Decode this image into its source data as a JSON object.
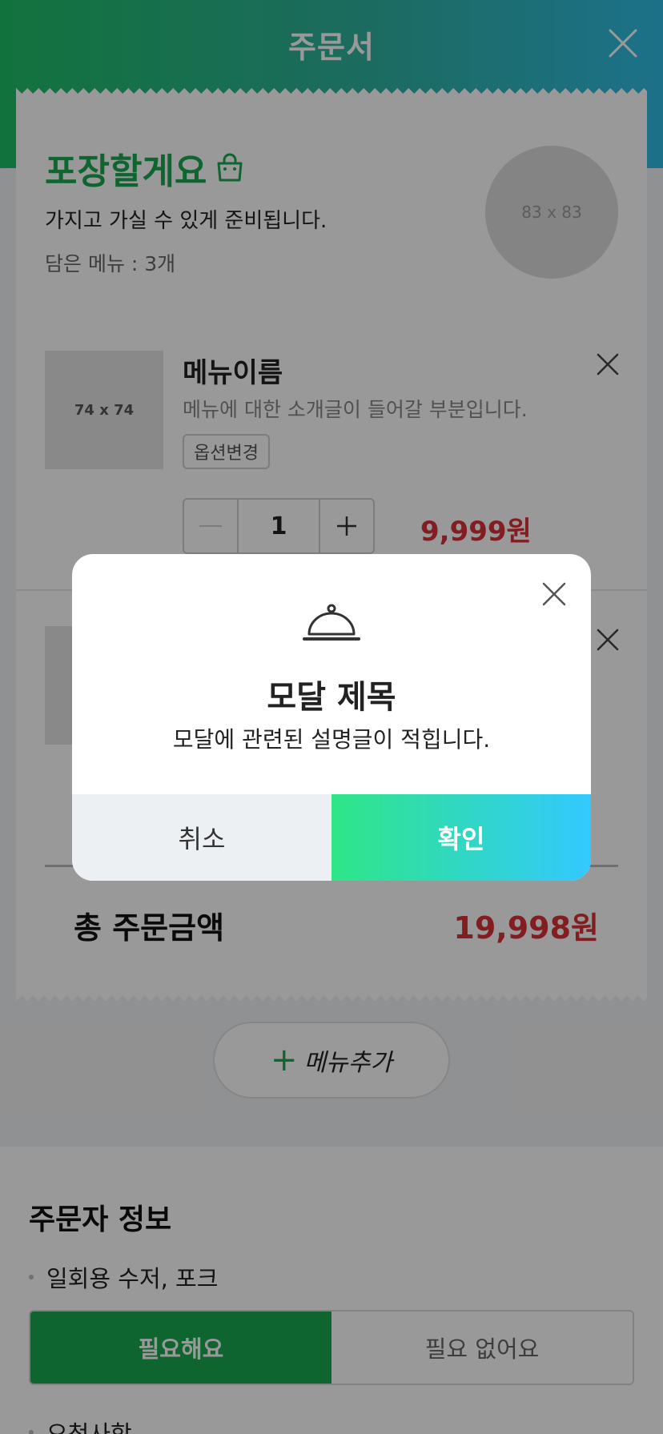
{
  "header": {
    "title": "주문서"
  },
  "order": {
    "mode_title": "포장할게요",
    "mode_desc": "가지고 가실 수 있게 준비됩니다.",
    "menu_count": "담은 메뉴 : 3개",
    "image_placeholder": "83 x 83"
  },
  "items": [
    {
      "thumb": "74 x 74",
      "name": "메뉴이름",
      "desc": "메뉴에 대한 소개글이 들어갈 부분입니다.",
      "option_label": "옵션변경",
      "quantity": "1",
      "price": "9,999원"
    }
  ],
  "total": {
    "label": "총 주문금액",
    "value": "19,998원"
  },
  "add_menu": {
    "label": "메뉴추가"
  },
  "orderer": {
    "title": "주문자 정보",
    "utensils_label": "일회용 수저, 포크",
    "need_label": "필요해요",
    "no_need_label": "필요 없어요",
    "request_label": "요청사항"
  },
  "modal": {
    "title": "모달 제목",
    "desc": "모달에 관련된 설명글이 적힙니다.",
    "cancel_label": "취소",
    "confirm_label": "확인"
  },
  "colors": {
    "brand_green": "#1aa84f",
    "price_red": "#d9333a",
    "confirm_gradient_start": "#2ee686",
    "confirm_gradient_end": "#33c9ff"
  },
  "icons": [
    "close-icon",
    "shopping-bag-icon",
    "minus-icon",
    "plus-icon",
    "food-cloche-icon"
  ]
}
